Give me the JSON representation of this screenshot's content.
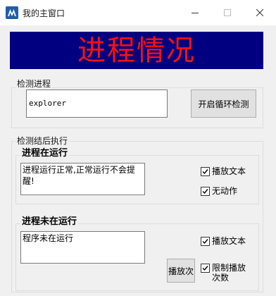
{
  "window": {
    "title": "我的主窗口",
    "icon": "app-logo-icon",
    "controls": [
      "minimize-icon",
      "maximize-icon",
      "close-icon"
    ]
  },
  "banner": {
    "text": "进程情况",
    "bg_color": "#000080",
    "text_color": "#ff1010"
  },
  "detect_group": {
    "label": "检测进程",
    "process_input": {
      "value": "explorer"
    },
    "start_button": "开启循环检测"
  },
  "result_group": {
    "label": "检测结后执行",
    "running": {
      "title": "进程在运行",
      "message": "进程运行正常,正常运行不会提醒!",
      "options": [
        {
          "label": "播放文本",
          "checked": true
        },
        {
          "label": "无动作",
          "checked": true
        }
      ]
    },
    "not_running": {
      "title": "进程未在运行",
      "message": "程序未在运行",
      "play_count_button": "播放次",
      "options": [
        {
          "label": "播放文本",
          "checked": true
        },
        {
          "label": "限制播放次数",
          "checked": true
        }
      ]
    }
  }
}
